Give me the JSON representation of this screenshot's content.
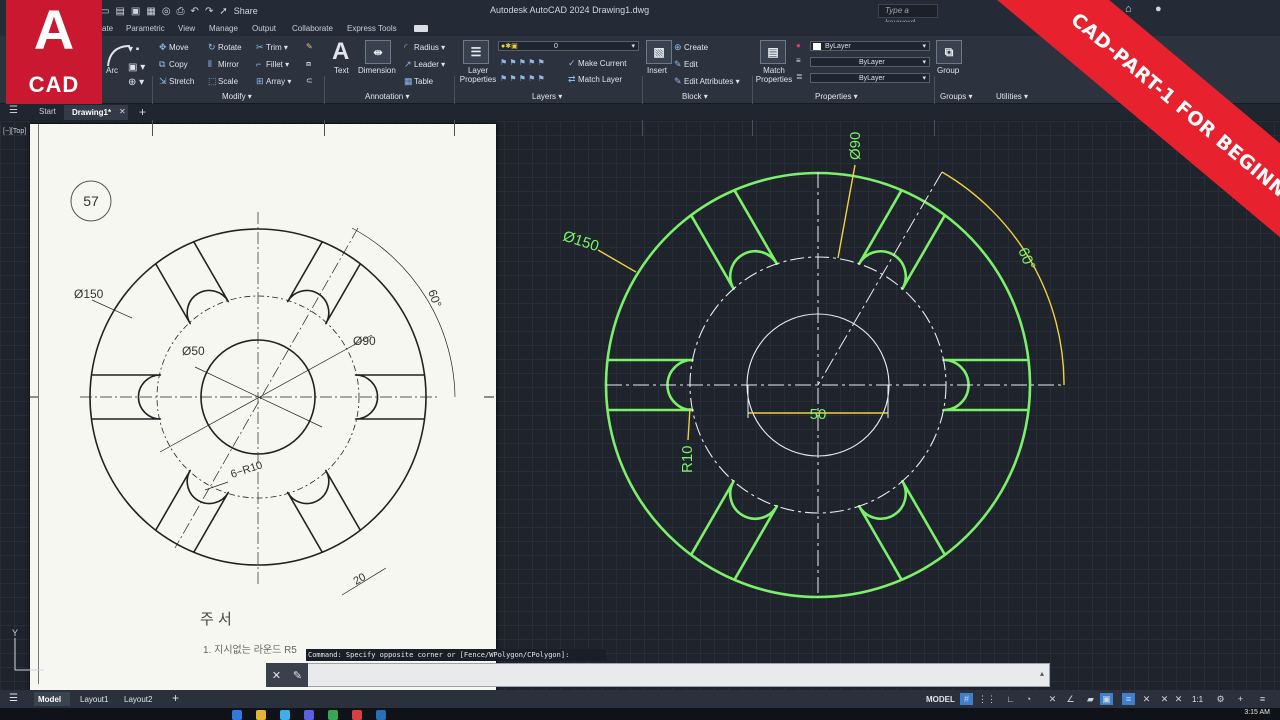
{
  "logo": {
    "letter": "A",
    "label": "CAD"
  },
  "banner": {
    "text": "CAD-PART-1 FOR BEGINNERS"
  },
  "titlebar": {
    "title": "Autodesk AutoCAD 2024    Drawing1.dwg",
    "share": "Share",
    "search_placeholder": "Type a keyword"
  },
  "ribbon_tabs": [
    "ate",
    "Parametric",
    "View",
    "Manage",
    "Output",
    "Collaborate",
    "Express Tools"
  ],
  "ribbon": {
    "draw": {
      "arc": "Arc"
    },
    "modify": {
      "move": "Move",
      "rotate": "Rotate",
      "trim": "Trim",
      "copy": "Copy",
      "mirror": "Mirror",
      "fillet": "Fillet",
      "stretch": "Stretch",
      "scale": "Scale",
      "array": "Array",
      "panel": "Modify ▾"
    },
    "annotation": {
      "text": "Text",
      "dimension": "Dimension",
      "radius": "Radius",
      "leader": "Leader",
      "table": "Table",
      "panel": "Annotation ▾"
    },
    "layers": {
      "layer_properties": "Layer Properties",
      "layer_value": "0",
      "make_current": "Make Current",
      "match_layer": "Match Layer",
      "panel": "Layers ▾"
    },
    "block": {
      "insert": "Insert",
      "create": "Create",
      "edit": "Edit",
      "edit_attributes": "Edit Attributes",
      "panel": "Block ▾"
    },
    "properties": {
      "match_properties": "Match Properties",
      "color": "ByLayer",
      "linetype": "ByLayer",
      "lineweight": "ByLayer",
      "panel": "Properties ▾"
    },
    "groups": {
      "group": "Group",
      "panel": "Groups ▾"
    },
    "utilities": {
      "panel": "Utilities ▾"
    }
  },
  "file_tabs": {
    "start": "Start",
    "drawing": "Drawing1*"
  },
  "viewport": {
    "label": "[−][Top]"
  },
  "reference": {
    "number": "57",
    "dims": {
      "d150": "Ø150",
      "d50": "Ø50",
      "d90": "Ø90",
      "angle": "60°",
      "r10": "6−R10",
      "w20": "20"
    },
    "notes_title": "주 서",
    "notes_line": "1. 지시없는 라운드 R5"
  },
  "drawing": {
    "dims": {
      "d150": "Ø150",
      "d90": "Ø90",
      "angle": "60°",
      "r10": "R10",
      "w50": "50"
    },
    "colors": {
      "outline": "#7df06a",
      "dim": "#f2d23c",
      "center": "#e9edf3"
    }
  },
  "command": {
    "history": "Command: Specify opposite corner or [Fence/WPolygon/CPolygon]:"
  },
  "status": {
    "model_tab": "Model",
    "layout1": "Layout1",
    "layout2": "Layout2",
    "model_btn": "MODEL",
    "scale": "1:1",
    "time": "3:15 AM"
  }
}
